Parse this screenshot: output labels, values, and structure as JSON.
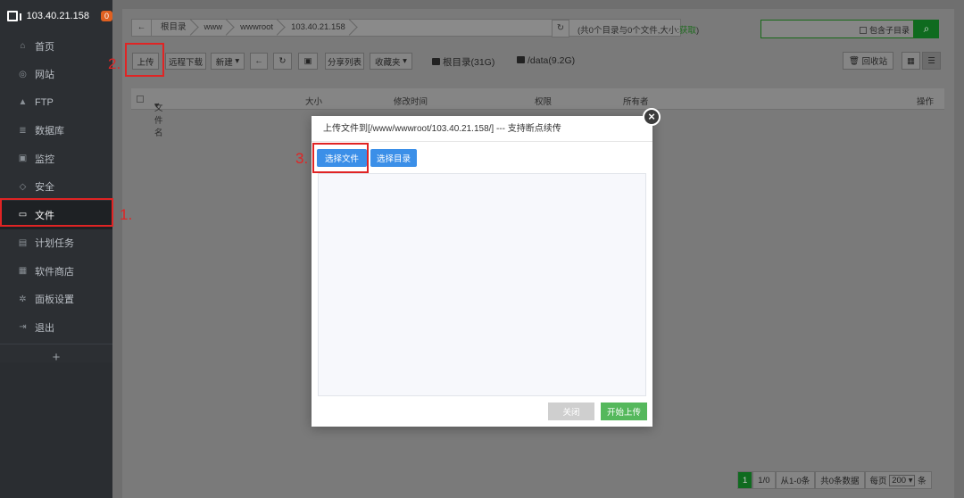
{
  "sidebar": {
    "server_ip": "103.40.21.158",
    "badge": "0",
    "items": [
      {
        "label": "首页",
        "icon": "home-icon"
      },
      {
        "label": "网站",
        "icon": "globe-icon"
      },
      {
        "label": "FTP",
        "icon": "ftp-icon"
      },
      {
        "label": "数据库",
        "icon": "database-icon"
      },
      {
        "label": "监控",
        "icon": "monitor-icon"
      },
      {
        "label": "安全",
        "icon": "shield-icon"
      },
      {
        "label": "文件",
        "icon": "folder-icon"
      },
      {
        "label": "计划任务",
        "icon": "calendar-icon"
      },
      {
        "label": "软件商店",
        "icon": "apps-icon"
      },
      {
        "label": "面板设置",
        "icon": "gear-icon"
      },
      {
        "label": "退出",
        "icon": "logout-icon"
      }
    ],
    "add": "+"
  },
  "path": {
    "crumbs": [
      "根目录",
      "www",
      "wwwroot",
      "103.40.21.158"
    ],
    "summary": "(共0个目录与0个文件,大小:",
    "get_link": "获取",
    "summary_end": ")"
  },
  "search": {
    "include_subdirs": "包含子目录"
  },
  "toolbar": {
    "upload": "上传",
    "remote_download": "远程下载",
    "new": "新建",
    "share_list": "分享列表",
    "favorites": "收藏夹",
    "disk_root": "根目录(31G)",
    "disk_data": "/data(9.2G)",
    "recycle_bin": "回收站"
  },
  "table": {
    "headers": [
      "文件名",
      "大小",
      "修改时间",
      "权限",
      "所有者",
      "操作"
    ]
  },
  "pager": {
    "current": "1",
    "pages": "1/0",
    "range": "从1-0条",
    "total": "共0条数据",
    "per_page_label": "每页",
    "per_page": "200",
    "unit": "条"
  },
  "annotations": {
    "step1": "1.",
    "step2": "2.",
    "step3": "3."
  },
  "modal": {
    "title": "上传文件到[/www/wwwroot/103.40.21.158/] --- 支持断点续传",
    "choose_file": "选择文件",
    "choose_dir": "选择目录",
    "close": "关闭",
    "start_upload": "开始上传"
  },
  "colors": {
    "sidebar_bg": "#2c2f33",
    "accent_green": "#20a53a",
    "button_blue": "#3b8fe8",
    "annotation_red": "#e02424",
    "badge_orange": "#e06020"
  }
}
